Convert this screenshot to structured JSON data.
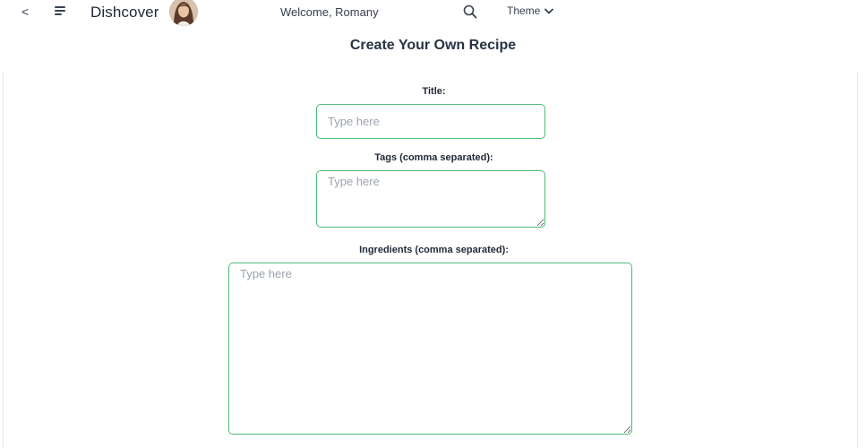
{
  "header": {
    "back_label": "<",
    "brand": "Dishcover",
    "welcome": "Welcome, Romany",
    "theme_label": "Theme",
    "accent_color": "#4dbb77"
  },
  "page": {
    "title": "Create Your Own Recipe"
  },
  "form": {
    "title_label": "Title:",
    "title_placeholder": "Type here",
    "title_value": "",
    "tags_label": "Tags (comma separated):",
    "tags_placeholder": "Type here",
    "tags_value": "",
    "ingredients_label": "Ingredients (comma separated):",
    "ingredients_placeholder": "Type here",
    "ingredients_value": ""
  },
  "icons": {
    "menu": "hamburger-menu-icon",
    "search": "search-icon",
    "theme_chevron": "chevron-down-icon",
    "avatar": "user-avatar"
  }
}
